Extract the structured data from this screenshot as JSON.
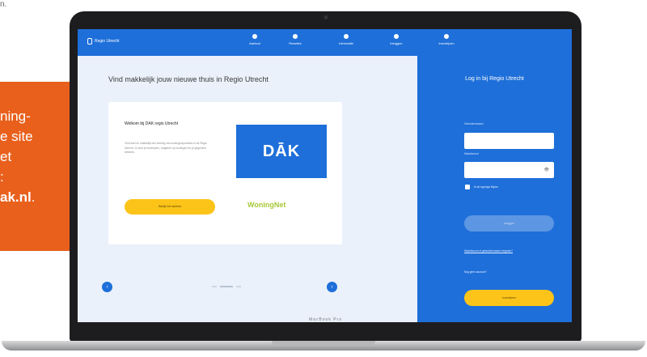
{
  "caption": "n.",
  "promo": {
    "lines": [
      "ning-",
      "e site",
      "et",
      ":"
    ],
    "link_text": "ak.nl",
    "link_suffix": "."
  },
  "laptop": {
    "brand": "MacBook Pro"
  },
  "app": {
    "logo": "Regio Utrecht",
    "nav": [
      {
        "label": "Aanbod",
        "icon": "home-icon"
      },
      {
        "label": "Reacties",
        "icon": "person-icon"
      },
      {
        "label": "Informatie",
        "icon": "info-icon"
      },
      {
        "label": "Inloggen",
        "icon": "user-icon"
      },
      {
        "label": "Inschrijven",
        "icon": "add-user-icon"
      }
    ]
  },
  "main": {
    "headline": "Vind makkelijk jouw nieuwe thuis in Regio Utrecht",
    "card": {
      "title": "Welkom bij DAK regio Utrecht",
      "text": "Vind snel en makkelijk een woning van woningcorporaties in de Regio Utrecht. Je kunt je inschrijven, reageren op woningen en je gegevens beheren.",
      "button": "Bekijk het aanbod",
      "logo_dak": "DĀK",
      "logo_woningnet": "WoningNet"
    },
    "carousel": {
      "prev": "‹",
      "next": "›",
      "slides": 3,
      "active": 1
    }
  },
  "login": {
    "title": "Log in bij Regio Utrecht",
    "username_label": "Gebruikersnaam",
    "password_label": "Wachtwoord",
    "remember_label": "Ik wil ingelogd blijven",
    "login_button": "Inloggen",
    "forgot_link": "Wachtwoord of gebruikersnaam vergeten?",
    "no_account": "Nog geen account?",
    "register_button": "Inschrijven"
  },
  "colors": {
    "primary": "#1e6fd9",
    "accent": "#fcc419",
    "orange": "#e8601c",
    "green": "#a8c837"
  }
}
